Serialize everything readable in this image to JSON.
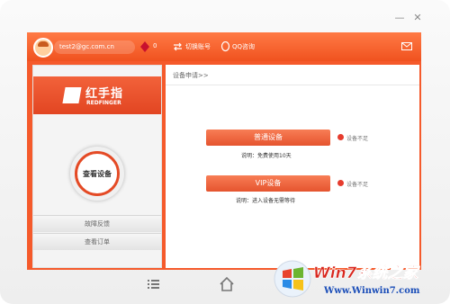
{
  "header": {
    "email": "test2@gc.com.cn",
    "count": "0",
    "switch_account": "切换账号",
    "qq_consult": "QQ咨询"
  },
  "sidebar": {
    "logo_cn": "红手指",
    "logo_en": "REDFINGER",
    "view_device": "查看设备",
    "feedback": "故障反馈",
    "orders": "查看订单"
  },
  "main": {
    "breadcrumb": "设备申请>>",
    "normal": {
      "button": "普通设备",
      "status": "设备不足",
      "description": "说明：免费使用10天"
    },
    "vip": {
      "button": "VIP设备",
      "status": "设备不足",
      "description": "说明：进入设备无需等待"
    }
  },
  "watermark": {
    "title": "Win7系统之家",
    "url": "Www.Winwin7.com"
  },
  "colors": {
    "brand": "#f55a2b",
    "button": "#f06a42",
    "warning_dot": "#e63c2e"
  }
}
